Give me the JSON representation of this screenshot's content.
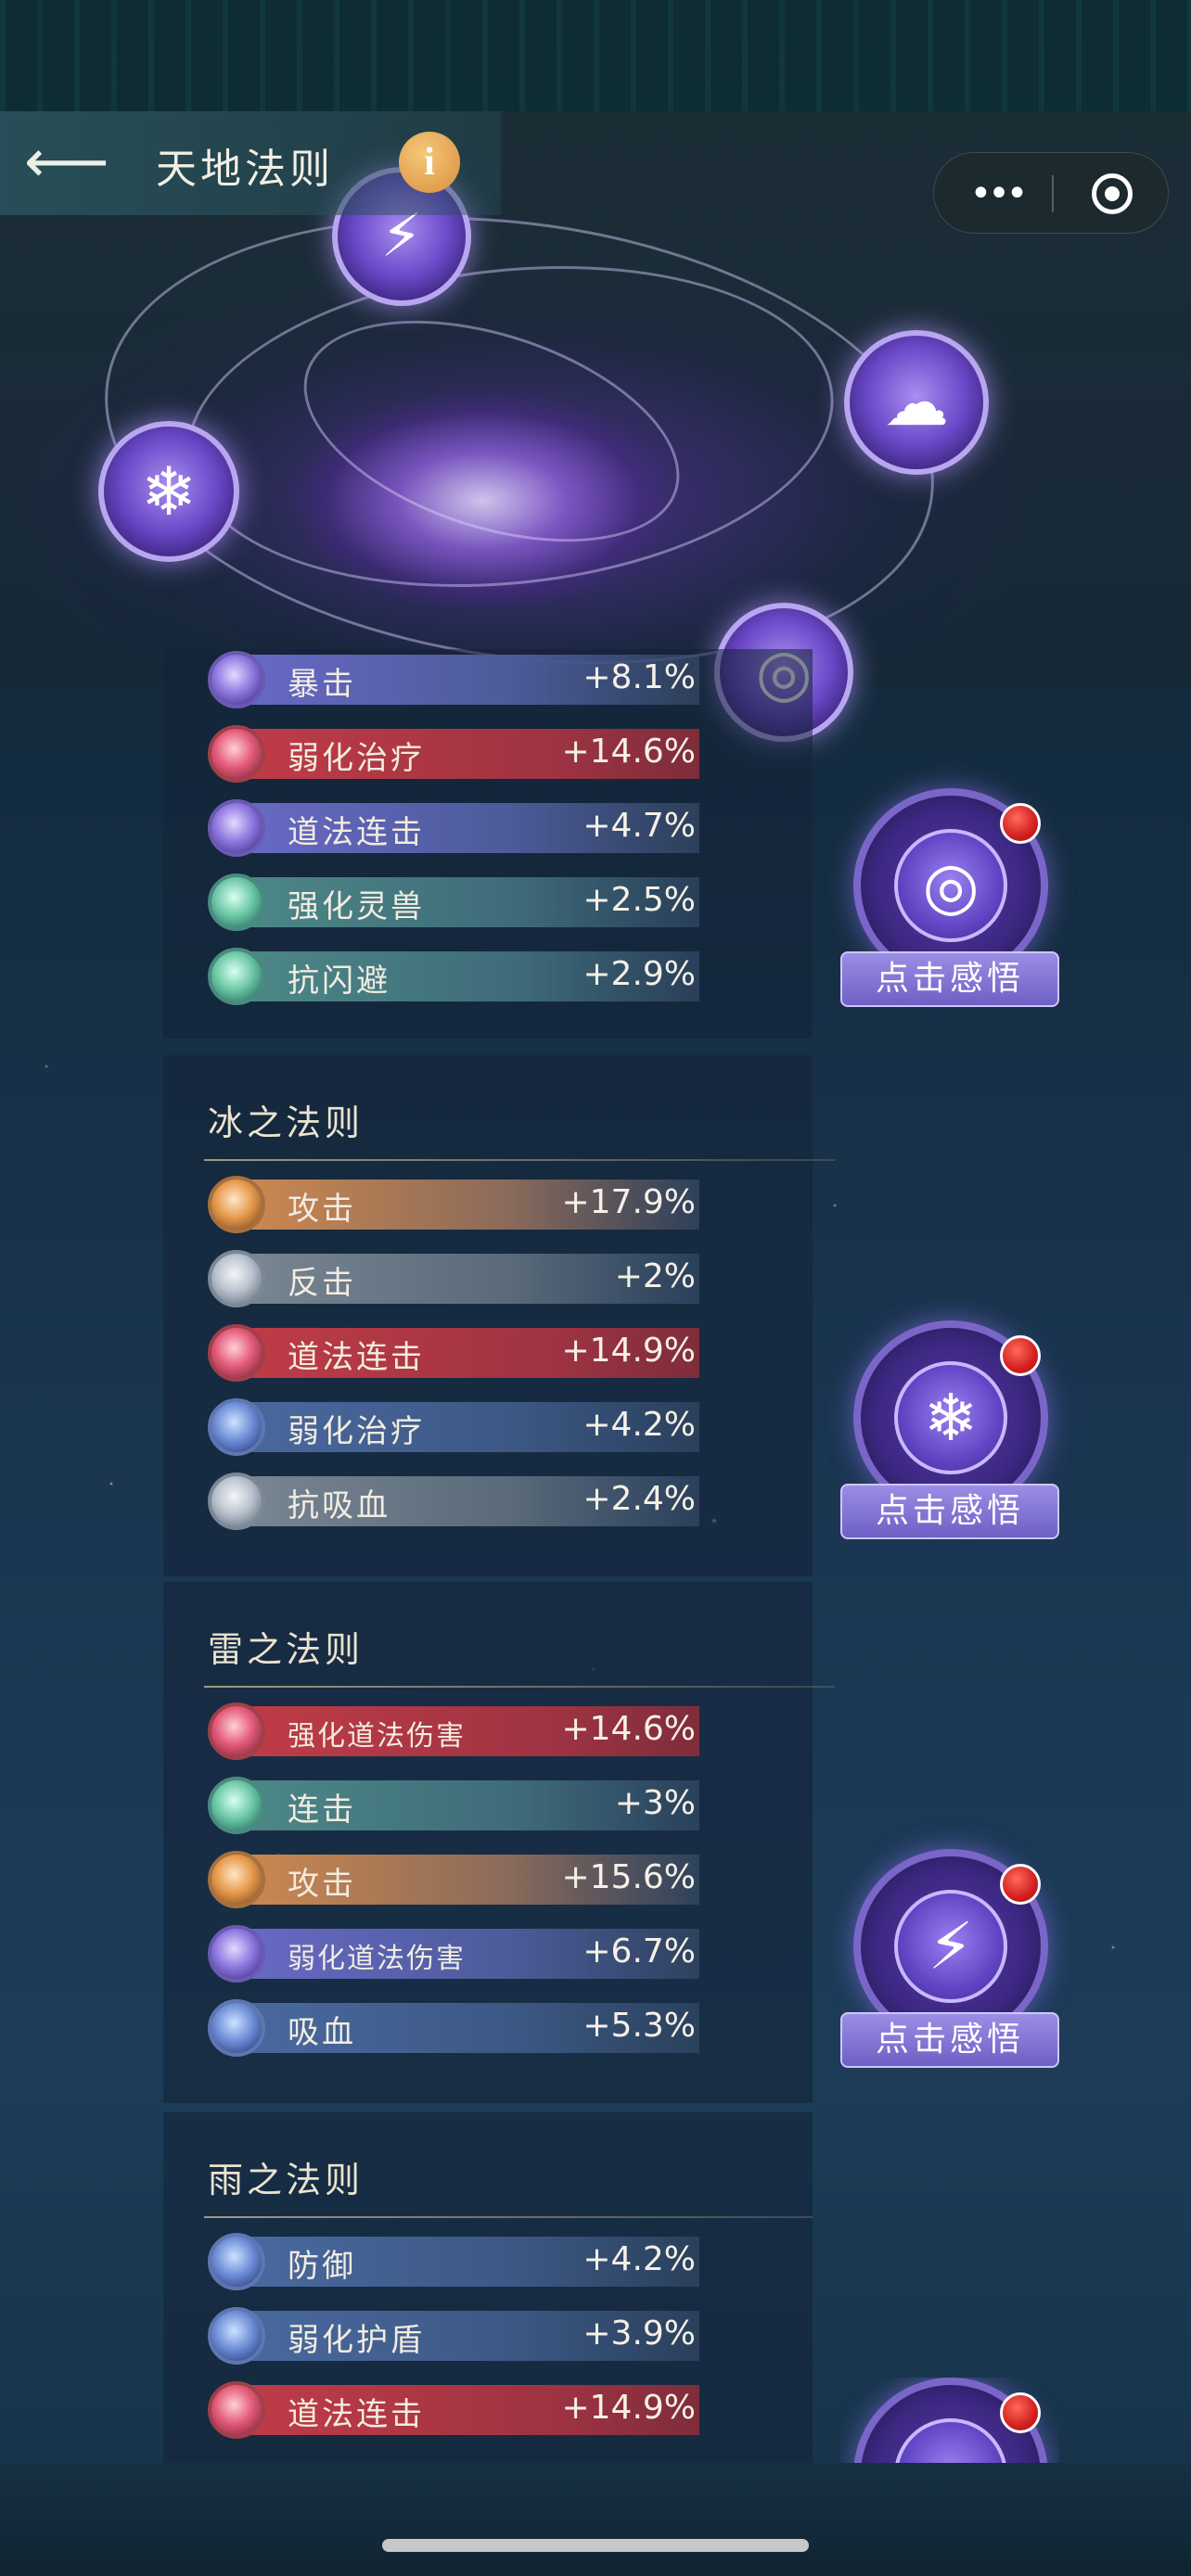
{
  "header": {
    "title": "天地法则",
    "back_icon": "back-arrow-icon",
    "info_glyph": "i"
  },
  "capsule": {
    "more_glyph": "•••"
  },
  "galaxy": {
    "orbs": [
      {
        "name": "thunder-orb",
        "glyph": "⚡"
      },
      {
        "name": "ice-orb",
        "glyph": "❄"
      },
      {
        "name": "cloud-orb",
        "glyph": "☁"
      },
      {
        "name": "wind-orb",
        "glyph": "◎"
      }
    ]
  },
  "laws": [
    {
      "title": "",
      "stats": [
        {
          "name": "暴击",
          "value": "+8.1%",
          "color": "purple"
        },
        {
          "name": "弱化治疗",
          "value": "+14.6%",
          "color": "red"
        },
        {
          "name": "道法连击",
          "value": "+4.7%",
          "color": "purple"
        },
        {
          "name": "强化灵兽",
          "value": "+2.5%",
          "color": "green"
        },
        {
          "name": "抗闪避",
          "value": "+2.9%",
          "color": "green"
        }
      ],
      "button": {
        "label": "点击感悟",
        "glyph": "◎"
      }
    },
    {
      "title": "冰之法则",
      "stats": [
        {
          "name": "攻击",
          "value": "+17.9%",
          "color": "orange"
        },
        {
          "name": "反击",
          "value": "+2%",
          "color": "gray"
        },
        {
          "name": "道法连击",
          "value": "+14.9%",
          "color": "red"
        },
        {
          "name": "弱化治疗",
          "value": "+4.2%",
          "color": "blue"
        },
        {
          "name": "抗吸血",
          "value": "+2.4%",
          "color": "gray"
        }
      ],
      "button": {
        "label": "点击感悟",
        "glyph": "❄"
      }
    },
    {
      "title": "雷之法则",
      "stats": [
        {
          "name": "强化道法伤害",
          "value": "+14.6%",
          "color": "red"
        },
        {
          "name": "连击",
          "value": "+3%",
          "color": "green"
        },
        {
          "name": "攻击",
          "value": "+15.6%",
          "color": "orange"
        },
        {
          "name": "弱化道法伤害",
          "value": "+6.7%",
          "color": "purple"
        },
        {
          "name": "吸血",
          "value": "+5.3%",
          "color": "blue"
        }
      ],
      "button": {
        "label": "点击感悟",
        "glyph": "⚡"
      }
    },
    {
      "title": "雨之法则",
      "stats": [
        {
          "name": "防御",
          "value": "+4.2%",
          "color": "blue"
        },
        {
          "name": "弱化护盾",
          "value": "+3.9%",
          "color": "blue"
        },
        {
          "name": "道法连击",
          "value": "+14.9%",
          "color": "red"
        }
      ],
      "button": {
        "label": "",
        "glyph": "☁"
      }
    }
  ]
}
